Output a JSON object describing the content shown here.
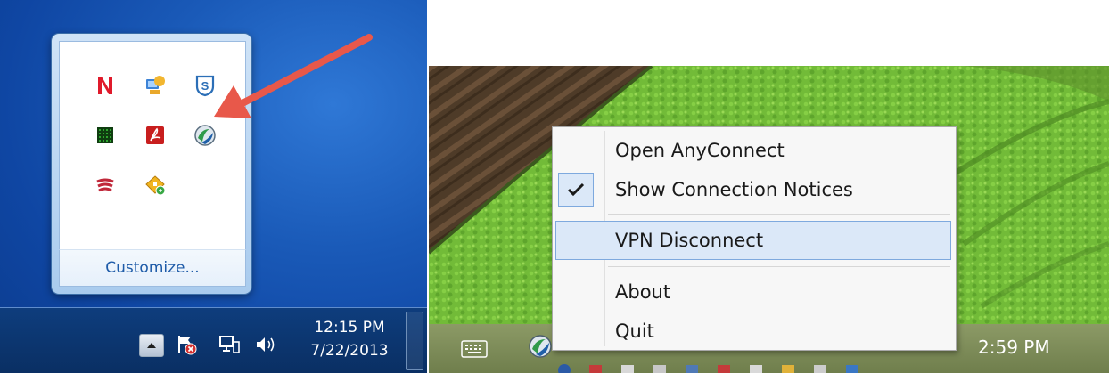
{
  "win7": {
    "customize_label": "Customize...",
    "clock_time": "12:15 PM",
    "clock_date": "7/22/2013",
    "overflow_icons": [
      "netflix-icon",
      "network-share-icon",
      "shield-s-icon",
      "green-grid-icon",
      "adobe-reader-icon",
      "anyconnect-icon",
      "red-stripes-icon",
      "yellow-update-icon"
    ],
    "system_tray_icons": [
      "show-hidden-icons-arrow",
      "action-center-flag-icon",
      "network-icon",
      "volume-icon"
    ],
    "highlight_color": "#e8584a"
  },
  "win10": {
    "clock_time": "2:59 PM",
    "menu": {
      "items": [
        {
          "label": "Open AnyConnect",
          "checked": false,
          "highlighted": false
        },
        {
          "label": "Show Connection Notices",
          "checked": true,
          "highlighted": false
        },
        {
          "label": "VPN Disconnect",
          "checked": false,
          "highlighted": true
        },
        {
          "label": "About",
          "checked": false,
          "highlighted": false
        },
        {
          "label": "Quit",
          "checked": false,
          "highlighted": false
        }
      ]
    },
    "taskbar_icons": [
      "touch-keyboard-icon",
      "anyconnect-icon"
    ],
    "accent_highlight": "#dbe8f8",
    "check_icon": "checkmark-icon"
  }
}
